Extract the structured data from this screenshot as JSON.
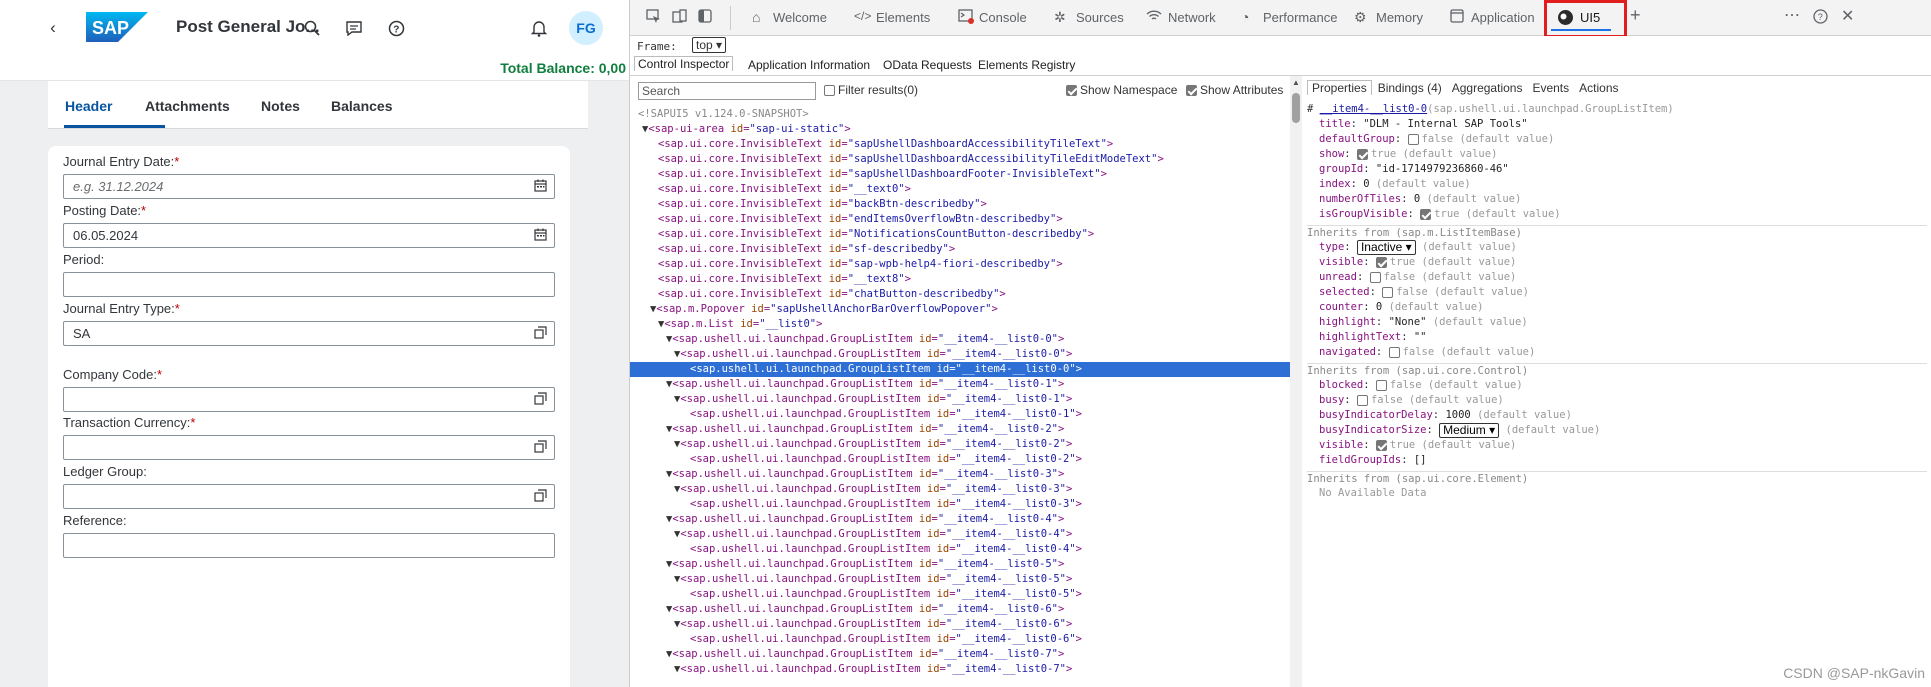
{
  "app": {
    "title": "Post General Jo...",
    "avatar": "FG",
    "total_balance": "Total Balance: 0,00",
    "tabs": [
      "Header",
      "Attachments",
      "Notes",
      "Balances"
    ],
    "fields": [
      {
        "label": "Journal Entry Date:",
        "required": "*",
        "value": "",
        "placeholder": "e.g. 31.12.2024",
        "icon": "calendar-icon"
      },
      {
        "label": "Posting Date:",
        "required": "*",
        "value": "06.05.2024",
        "placeholder": "",
        "icon": "calendar-icon"
      },
      {
        "label": "Period:",
        "required": "",
        "value": "",
        "placeholder": "",
        "icon": ""
      },
      {
        "label": "Journal Entry Type:",
        "required": "*",
        "value": "SA",
        "placeholder": "",
        "icon": "value-help-icon"
      },
      {
        "label": "Company Code:",
        "required": "*",
        "value": "",
        "placeholder": "",
        "icon": "value-help-icon"
      },
      {
        "label": "Transaction Currency:",
        "required": "*",
        "value": "",
        "placeholder": "",
        "icon": "value-help-icon"
      },
      {
        "label": "Ledger Group:",
        "required": "",
        "value": "",
        "placeholder": "",
        "icon": "value-help-icon"
      },
      {
        "label": "Reference:",
        "required": "",
        "value": "",
        "placeholder": "",
        "icon": ""
      }
    ]
  },
  "devtools": {
    "tabs": [
      "Welcome",
      "Elements",
      "Console",
      "Sources",
      "Network",
      "Performance",
      "Memory",
      "Application",
      "UI5"
    ],
    "active_tab": "UI5",
    "frame_label": "Frame:",
    "frame_value": "top",
    "subtabs": [
      "Control Inspector",
      "Application Information",
      "OData Requests",
      "Elements Registry"
    ],
    "search_placeholder": "Search",
    "filter_label": "Filter results(0)",
    "show_namespace": "Show Namespace",
    "show_attributes": "Show Attributes",
    "tree_comment": "<!SAPUI5 v1.124.0-SNAPSHOT>",
    "tree": [
      {
        "indent": 0,
        "arrow": "▼",
        "tag": "sap-ui-area",
        "attr": "id",
        "val": "sap-ui-static",
        "close": ">"
      },
      {
        "indent": 1,
        "arrow": "",
        "tag": "sap.ui.core.InvisibleText",
        "attr": "id",
        "val": "sapUshellDashboardAccessibilityTileText",
        "close": ">"
      },
      {
        "indent": 1,
        "arrow": "",
        "tag": "sap.ui.core.InvisibleText",
        "attr": "id",
        "val": "sapUshellDashboardAccessibilityTileEditModeText",
        "close": ">"
      },
      {
        "indent": 1,
        "arrow": "",
        "tag": "sap.ui.core.InvisibleText",
        "attr": "id",
        "val": "sapUshellDashboardFooter-InvisibleText",
        "close": ">"
      },
      {
        "indent": 1,
        "arrow": "",
        "tag": "sap.ui.core.InvisibleText",
        "attr": "id",
        "val": "__text0",
        "close": ">"
      },
      {
        "indent": 1,
        "arrow": "",
        "tag": "sap.ui.core.InvisibleText",
        "attr": "id",
        "val": "backBtn-describedby",
        "close": ">"
      },
      {
        "indent": 1,
        "arrow": "",
        "tag": "sap.ui.core.InvisibleText",
        "attr": "id",
        "val": "endItemsOverflowBtn-describedby",
        "close": ">"
      },
      {
        "indent": 1,
        "arrow": "",
        "tag": "sap.ui.core.InvisibleText",
        "attr": "id",
        "val": "NotificationsCountButton-describedby",
        "close": ">"
      },
      {
        "indent": 1,
        "arrow": "",
        "tag": "sap.ui.core.InvisibleText",
        "attr": "id",
        "val": "sf-describedby",
        "close": ">"
      },
      {
        "indent": 1,
        "arrow": "",
        "tag": "sap.ui.core.InvisibleText",
        "attr": "id",
        "val": "sap-wpb-help4-fiori-describedby",
        "close": ">"
      },
      {
        "indent": 1,
        "arrow": "",
        "tag": "sap.ui.core.InvisibleText",
        "attr": "id",
        "val": "__text8",
        "close": ">"
      },
      {
        "indent": 1,
        "arrow": "",
        "tag": "sap.ui.core.InvisibleText",
        "attr": "id",
        "val": "chatButton-describedby",
        "close": ">"
      },
      {
        "indent": 1,
        "arrow": "▼",
        "tag": "sap.m.Popover",
        "attr": "id",
        "val": "sapUshellAnchorBarOverflowPopover",
        "close": ">"
      },
      {
        "indent": 2,
        "arrow": "▼",
        "tag": "sap.m.List",
        "attr": "id",
        "val": "__list0",
        "close": ">"
      },
      {
        "indent": 3,
        "arrow": "▼",
        "tag": "sap.ushell.ui.launchpad.GroupListItem",
        "attr": "id",
        "val": "__item4-__list0-0",
        "close": ">"
      },
      {
        "indent": 4,
        "arrow": "▼",
        "tag": "sap.ushell.ui.launchpad.GroupListItem",
        "attr": "id",
        "val": "__item4-__list0-0",
        "close": ">"
      },
      {
        "indent": 5,
        "arrow": "",
        "tag": "sap.ushell.ui.launchpad.GroupListItem",
        "attr": "id",
        "val": "__item4-__list0-0",
        "close": ">",
        "selected": true
      },
      {
        "indent": 3,
        "arrow": "▼",
        "tag": "sap.ushell.ui.launchpad.GroupListItem",
        "attr": "id",
        "val": "__item4-__list0-1",
        "close": ">"
      },
      {
        "indent": 4,
        "arrow": "▼",
        "tag": "sap.ushell.ui.launchpad.GroupListItem",
        "attr": "id",
        "val": "__item4-__list0-1",
        "close": ">"
      },
      {
        "indent": 5,
        "arrow": "",
        "tag": "sap.ushell.ui.launchpad.GroupListItem",
        "attr": "id",
        "val": "__item4-__list0-1",
        "close": ">"
      },
      {
        "indent": 3,
        "arrow": "▼",
        "tag": "sap.ushell.ui.launchpad.GroupListItem",
        "attr": "id",
        "val": "__item4-__list0-2",
        "close": ">"
      },
      {
        "indent": 4,
        "arrow": "▼",
        "tag": "sap.ushell.ui.launchpad.GroupListItem",
        "attr": "id",
        "val": "__item4-__list0-2",
        "close": ">"
      },
      {
        "indent": 5,
        "arrow": "",
        "tag": "sap.ushell.ui.launchpad.GroupListItem",
        "attr": "id",
        "val": "__item4-__list0-2",
        "close": ">"
      },
      {
        "indent": 3,
        "arrow": "▼",
        "tag": "sap.ushell.ui.launchpad.GroupListItem",
        "attr": "id",
        "val": "__item4-__list0-3",
        "close": ">"
      },
      {
        "indent": 4,
        "arrow": "▼",
        "tag": "sap.ushell.ui.launchpad.GroupListItem",
        "attr": "id",
        "val": "__item4-__list0-3",
        "close": ">"
      },
      {
        "indent": 5,
        "arrow": "",
        "tag": "sap.ushell.ui.launchpad.GroupListItem",
        "attr": "id",
        "val": "__item4-__list0-3",
        "close": ">"
      },
      {
        "indent": 3,
        "arrow": "▼",
        "tag": "sap.ushell.ui.launchpad.GroupListItem",
        "attr": "id",
        "val": "__item4-__list0-4",
        "close": ">"
      },
      {
        "indent": 4,
        "arrow": "▼",
        "tag": "sap.ushell.ui.launchpad.GroupListItem",
        "attr": "id",
        "val": "__item4-__list0-4",
        "close": ">"
      },
      {
        "indent": 5,
        "arrow": "",
        "tag": "sap.ushell.ui.launchpad.GroupListItem",
        "attr": "id",
        "val": "__item4-__list0-4",
        "close": ">"
      },
      {
        "indent": 3,
        "arrow": "▼",
        "tag": "sap.ushell.ui.launchpad.GroupListItem",
        "attr": "id",
        "val": "__item4-__list0-5",
        "close": ">"
      },
      {
        "indent": 4,
        "arrow": "▼",
        "tag": "sap.ushell.ui.launchpad.GroupListItem",
        "attr": "id",
        "val": "__item4-__list0-5",
        "close": ">"
      },
      {
        "indent": 5,
        "arrow": "",
        "tag": "sap.ushell.ui.launchpad.GroupListItem",
        "attr": "id",
        "val": "__item4-__list0-5",
        "close": ">"
      },
      {
        "indent": 3,
        "arrow": "▼",
        "tag": "sap.ushell.ui.launchpad.GroupListItem",
        "attr": "id",
        "val": "__item4-__list0-6",
        "close": ">"
      },
      {
        "indent": 4,
        "arrow": "▼",
        "tag": "sap.ushell.ui.launchpad.GroupListItem",
        "attr": "id",
        "val": "__item4-__list0-6",
        "close": ">"
      },
      {
        "indent": 5,
        "arrow": "",
        "tag": "sap.ushell.ui.launchpad.GroupListItem",
        "attr": "id",
        "val": "__item4-__list0-6",
        "close": ">"
      },
      {
        "indent": 3,
        "arrow": "▼",
        "tag": "sap.ushell.ui.launchpad.GroupListItem",
        "attr": "id",
        "val": "__item4-__list0-7",
        "close": ">"
      },
      {
        "indent": 4,
        "arrow": "▼",
        "tag": "sap.ushell.ui.launchpad.GroupListItem",
        "attr": "id",
        "val": "__item4-__list0-7",
        "close": ">"
      }
    ],
    "prop_tabs": [
      "Properties",
      "Bindings (4)",
      "Aggregations",
      "Events",
      "Actions"
    ],
    "selected_id": "__item4-__list0-0",
    "selected_class": "(sap.ushell.ui.launchpad.GroupListItem)",
    "props": [
      {
        "k": "title",
        "v": "\"DLM - Internal SAP Tools\"",
        "d": ""
      },
      {
        "k": "defaultGroup",
        "cb": "off",
        "v": "false",
        "d": "(default value)"
      },
      {
        "k": "show",
        "cb": "on",
        "v": "true",
        "d": "(default value)"
      },
      {
        "k": "groupId",
        "v": "\"id-1714979236860-46\"",
        "d": ""
      },
      {
        "k": "index",
        "v": "0",
        "d": "(default value)"
      },
      {
        "k": "numberOfTiles",
        "v": "0",
        "d": "(default value)"
      },
      {
        "k": "isGroupVisible",
        "cb": "on",
        "v": "true",
        "d": "(default value)"
      }
    ],
    "inherit1": "Inherits from (sap.m.ListItemBase)",
    "props2": [
      {
        "k": "type",
        "sel": "Inactive",
        "d": "(default value)"
      },
      {
        "k": "visible",
        "cb": "on",
        "v": "true",
        "d": "(default value)"
      },
      {
        "k": "unread",
        "cb": "off",
        "v": "false",
        "d": "(default value)"
      },
      {
        "k": "selected",
        "cb": "off",
        "v": "false",
        "d": "(default value)"
      },
      {
        "k": "counter",
        "v": "0",
        "d": "(default value)"
      },
      {
        "k": "highlight",
        "v": "\"None\"",
        "d": "(default value)"
      },
      {
        "k": "highlightText",
        "v": "\"\"",
        "d": ""
      },
      {
        "k": "navigated",
        "cb": "off",
        "v": "false",
        "d": "(default value)"
      }
    ],
    "inherit2": "Inherits from (sap.ui.core.Control)",
    "props3": [
      {
        "k": "blocked",
        "cb": "off",
        "v": "false",
        "d": "(default value)"
      },
      {
        "k": "busy",
        "cb": "off",
        "v": "false",
        "d": "(default value)"
      },
      {
        "k": "busyIndicatorDelay",
        "v": "1000",
        "d": "(default value)"
      },
      {
        "k": "busyIndicatorSize",
        "sel": "Medium",
        "d": "(default value)"
      },
      {
        "k": "visible",
        "cb": "on",
        "v": "true",
        "d": "(default value)"
      },
      {
        "k": "fieldGroupIds",
        "v": "[]",
        "d": ""
      }
    ],
    "inherit3": "Inherits from (sap.ui.core.Element)",
    "no_data": "No Available Data"
  },
  "watermark": "CSDN @SAP-nkGavin"
}
